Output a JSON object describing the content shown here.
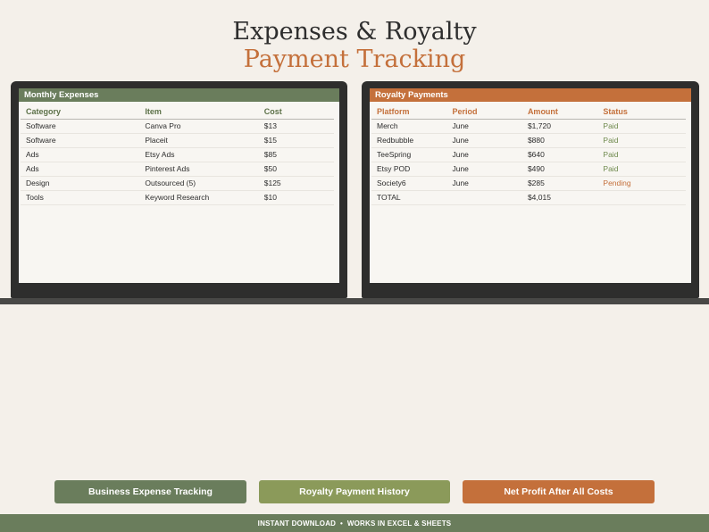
{
  "header": {
    "title_line1": "Expenses & Royalty",
    "title_line2": "Payment Tracking"
  },
  "expenses": {
    "title": "Monthly Expenses",
    "columns": [
      "Category",
      "Item",
      "Cost"
    ],
    "rows": [
      [
        "Software",
        "Canva Pro",
        "$13"
      ],
      [
        "Software",
        "Placeit",
        "$15"
      ],
      [
        "Ads",
        "Etsy Ads",
        "$85"
      ],
      [
        "Ads",
        "Pinterest Ads",
        "$50"
      ],
      [
        "Design",
        "Outsourced (5)",
        "$125"
      ],
      [
        "Tools",
        "Keyword Research",
        "$10"
      ]
    ]
  },
  "royalties": {
    "title": "Royalty Payments",
    "columns": [
      "Platform",
      "Period",
      "Amount",
      "Status"
    ],
    "rows": [
      [
        "Merch",
        "June",
        "$1,720",
        "Paid"
      ],
      [
        "Redbubble",
        "June",
        "$880",
        "Paid"
      ],
      [
        "TeeSpring",
        "June",
        "$640",
        "Paid"
      ],
      [
        "Etsy POD",
        "June",
        "$490",
        "Paid"
      ],
      [
        "Society6",
        "June",
        "$285",
        "Pending"
      ],
      [
        "TOTAL",
        "",
        "$4,015",
        ""
      ]
    ]
  },
  "features": {
    "expense": "Business Expense Tracking",
    "royalty": "Royalty Payment History",
    "profit": "Net Profit After All Costs"
  },
  "footer": {
    "text": "INSTANT DOWNLOAD  •  WORKS IN EXCEL & SHEETS"
  },
  "colors": {
    "background": "#f4f0ea",
    "green": "#6a7d5c",
    "olive": "#8b9a5a",
    "orange": "#c4703b",
    "laptop": "#2e2e2d"
  }
}
